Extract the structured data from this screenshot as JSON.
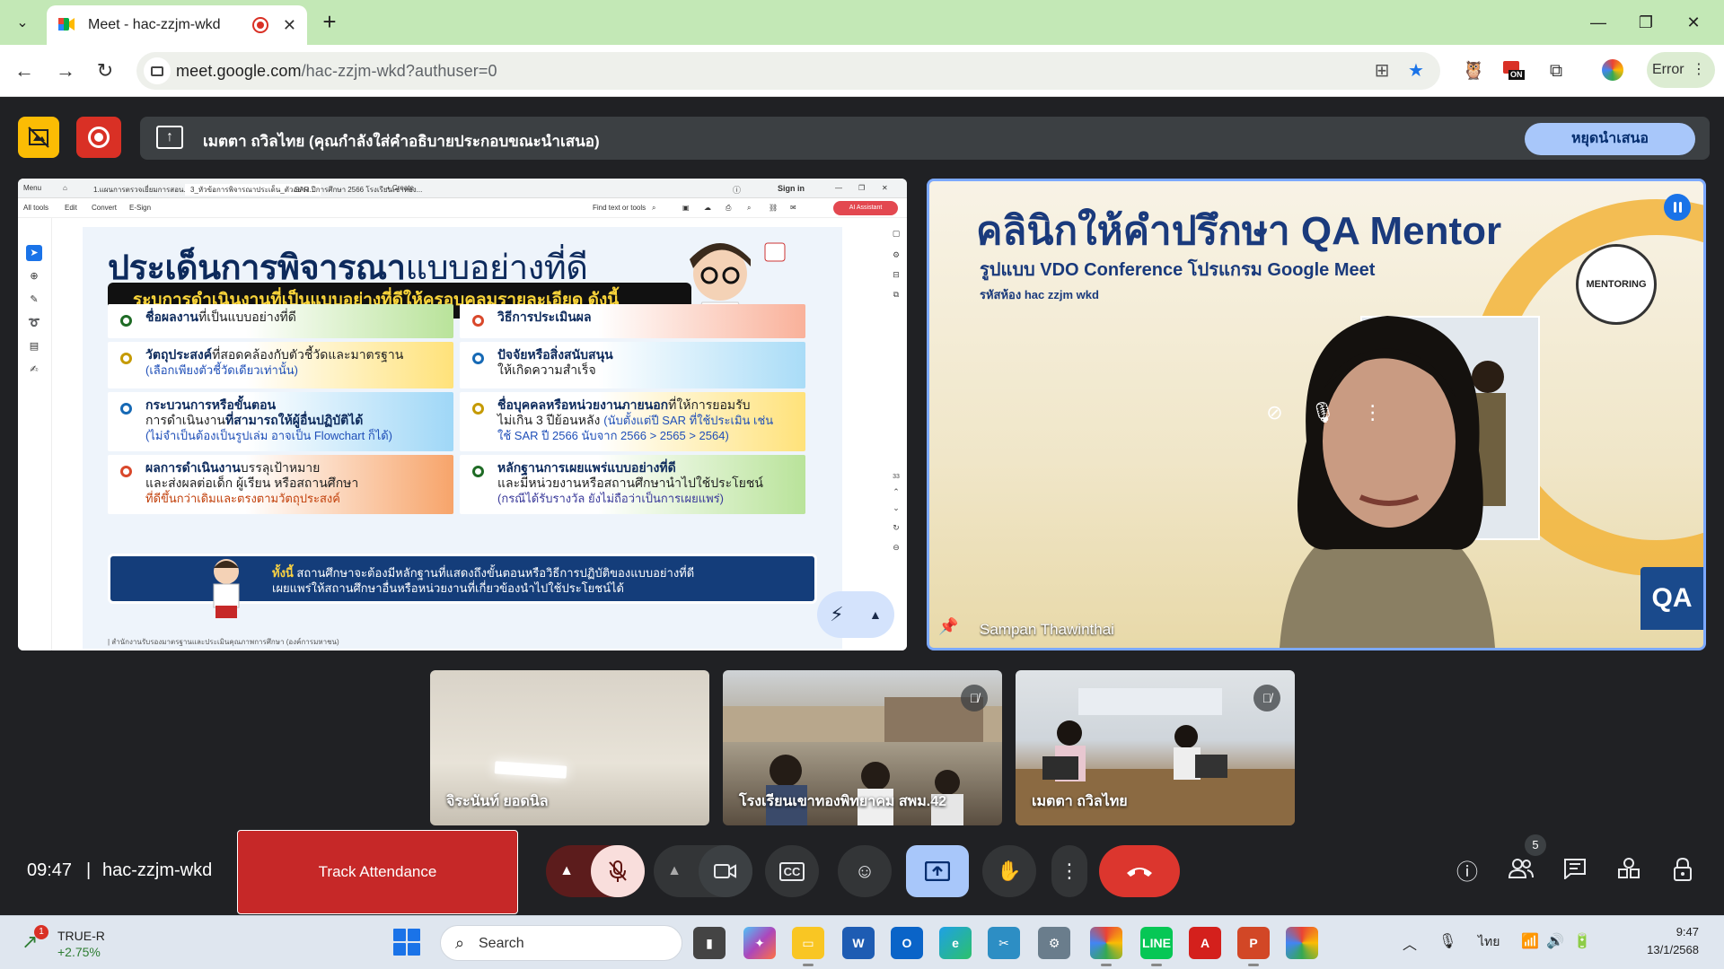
{
  "browser": {
    "tab_title": "Meet - hac-zzjm-wkd",
    "url_domain": "meet.google.com",
    "url_path": "/hac-zzjm-wkd?authuser=0",
    "profile_label": "Error",
    "extension_badge": "ON"
  },
  "meet": {
    "presenting_text": "เมตตา ถวิลไทย (คุณกำลังใส่คำอธิบายประกอบขณะนำเสนอ)",
    "stop_presenting_label": "หยุดนำเสนอ",
    "time": "09:47",
    "separator": "|",
    "meeting_code": "hac-zzjm-wkd",
    "track_attendance_label": "Track Attendance",
    "people_count": "5",
    "speaker_name": "Sampan Thawinthai",
    "participants": [
      {
        "name": "จิระนันท์ ยอดนิล"
      },
      {
        "name": "โรงเรียนเขาทองพิทยาคม สพม.42"
      },
      {
        "name": "เมตตา ถวิลไทย"
      }
    ]
  },
  "pdf": {
    "menu": "Menu",
    "tab1": "1.แผนการตรวจเยี่ยมการสอน.pdf",
    "tab2": "3_หัวข้อการพิจารณาประเด็น_ตัวอย่าง...",
    "tab3": "SAR ปีการศึกษา 2566 โรงเรียนเขาทอง...",
    "tab4": "+ Create",
    "sign_in": "Sign in",
    "menu_all_tools": "All tools",
    "menu_edit": "Edit",
    "menu_convert": "Convert",
    "menu_esign": "E-Sign",
    "find_text": "Find text or tools",
    "ai_assistant": "AI Assistant",
    "page_number": "33"
  },
  "slide": {
    "title_bold": "ประเด็นการพิจารณา",
    "title_thin": "แบบอย่างที่ดี",
    "subtitle": "ระบุการดำเนินงานที่เป็นแบบอย่างที่ดีให้ครอบคลุมรายละเอียด ดังนี้",
    "c1_bold": "ชื่อผลงาน",
    "c1_rest": "ที่เป็นแบบอย่างที่ดี",
    "c2_bold": "วัตถุประสงค์",
    "c2_rest": "ที่สอดคล้องกับตัวชี้วัดและมาตรฐาน",
    "c2_note": "(เลือกเพียงตัวชี้วัดเดียวเท่านั้น)",
    "c3_bold": "กระบวนการหรือขั้นตอน",
    "c3_line2_a": "การดำเนินงาน",
    "c3_line2_b": "ที่สามารถให้ผู้อื่นปฏิบัติได้",
    "c3_note": "(ไม่จำเป็นต้องเป็นรูปเล่ม อาจเป็น Flowchart ก็ได้)",
    "c4_bold": "ผลการดำเนินงาน",
    "c4_rest": "บรรลุเป้าหมาย",
    "c4_line2": "และส่งผลต่อเด็ก ผู้เรียน หรือสถานศึกษา",
    "c4_note": "ที่ดีขึ้นกว่าเดิมและตรงตามวัตถุประสงค์",
    "c5_bold": "วิธีการประเมินผล",
    "c6_bold": "ปัจจัยหรือสิ่งสนับสนุน",
    "c6_line2": "ให้เกิดความสำเร็จ",
    "c7_bold": "ชื่อบุคคลหรือหน่วยงานภายนอก",
    "c7_rest": "ที่ให้การยอมรับ",
    "c7_line2": "ไม่เกิน 3 ปีย้อนหลัง",
    "c7_note1": "(นับตั้งแต่ปี SAR ที่ใช้ประเมิน เช่น",
    "c7_note2": "ใช้ SAR ปี 2566 นับจาก 2566 > 2565 > 2564)",
    "c8_bold": "หลักฐานการเผยแพร่แบบอย่างที่ดี",
    "c8_line2": "และมีหน่วยงานหรือสถานศึกษานำไปใช้ประโยชน์",
    "c8_note": "(กรณีได้รับรางวัล ยังไม่ถือว่าเป็นการเผยแพร่)",
    "footer_bold": "ทั้งนี้",
    "footer_line1": " สถานศึกษาจะต้องมีหลักฐานที่แสดงถึงขั้นตอนหรือวิธีการปฏิบัติของแบบอย่างที่ดี",
    "footer_line2": "เผยแพร่ให้สถานศึกษาอื่นหรือหน่วยงานที่เกี่ยวข้องนำไปใช้ประโยชน์ได้",
    "bottom_note": "| สำนักงานรับรองมาตรฐานและประเมินคุณภาพการศึกษา (องค์การมหาชน)"
  },
  "background_board": {
    "title": "คลินิกให้คำปรึกษา QA Mentor",
    "subtitle": "รูปแบบ VDO Conference โปรแกรม Google Meet",
    "room": "รหัสห้อง hac zzjm wkd",
    "badge": "MENTORING",
    "logo": "QA"
  },
  "taskbar": {
    "stock_name": "TRUE-R",
    "stock_change": "+2.75%",
    "stock_badge": "1",
    "search_label": "Search",
    "language": "ไทย",
    "time": "9:47",
    "date": "13/1/2568"
  },
  "colors": {
    "accent": "#a8c7fa",
    "record": "#d93025",
    "leave": "#dc362e",
    "track": "#c62828",
    "chrome_frame": "#c3e8b6"
  }
}
